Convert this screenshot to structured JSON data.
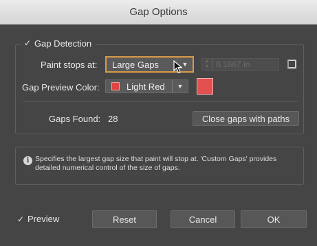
{
  "window": {
    "title": "Gap Options"
  },
  "gap_detection": {
    "label": "Gap Detection",
    "checked": true
  },
  "paint_stops": {
    "label": "Paint stops at:",
    "value": "Large Gaps",
    "custom_value": "0.1667 in"
  },
  "gap_preview": {
    "label": "Gap Preview Color:",
    "value": "Light Red",
    "color": "#e04545"
  },
  "gaps_found": {
    "label": "Gaps Found:",
    "count": "28"
  },
  "buttons": {
    "close_gaps": "Close gaps with paths",
    "reset": "Reset",
    "cancel": "Cancel",
    "ok": "OK"
  },
  "info": {
    "icon": "info-icon",
    "text": "Specifies the largest gap size that paint will stop at. 'Custom Gaps' provides detailed numerical control of the size of gaps."
  },
  "preview": {
    "label": "Preview",
    "checked": true
  },
  "colors": {
    "accent_focus": "#d79a48",
    "background": "#454545"
  }
}
